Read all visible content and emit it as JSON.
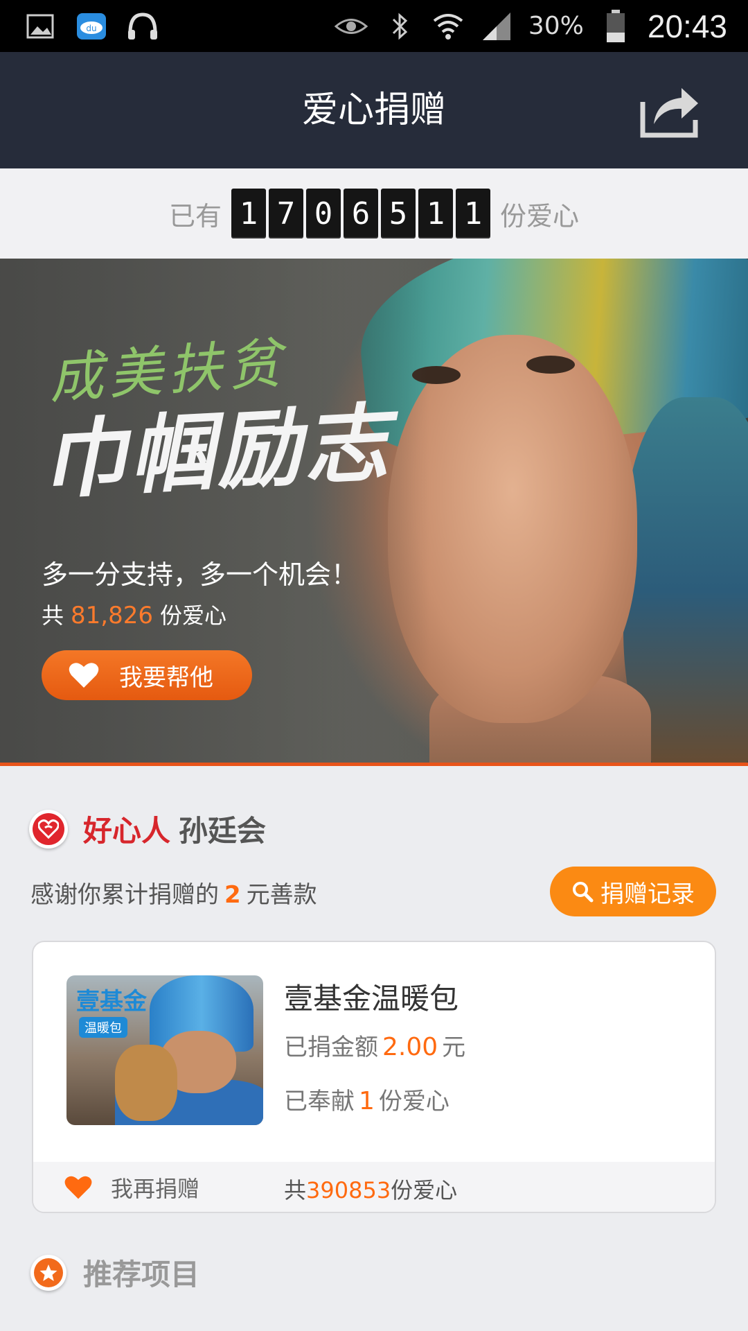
{
  "status_bar": {
    "left_icons": [
      "image-icon",
      "baidu-cloud-icon",
      "headphones-icon"
    ],
    "right_icons": [
      "eye-icon",
      "bluetooth-icon",
      "wifi-icon",
      "signal-icon",
      "battery-icon"
    ],
    "battery": "30%",
    "time": "20:43"
  },
  "header": {
    "title": "爱心捐赠",
    "share_icon": "share-icon"
  },
  "counter": {
    "prefix": "已有",
    "digits": [
      "1",
      "7",
      "0",
      "6",
      "5",
      "1",
      "1"
    ],
    "suffix": "份爱心"
  },
  "banner": {
    "brush_line1": "成美扶贫",
    "brush_line2": "巾帼励志",
    "slogan": "多一分支持，多一个机会！",
    "total_prefix": "共",
    "total_value": "81,826",
    "total_suffix": "份爱心",
    "help_button": "我要帮他"
  },
  "donor": {
    "title_prefix": "好心人",
    "name": "孙廷会",
    "thanks_prefix": "感谢你累计捐赠的",
    "thanks_amount": "2",
    "thanks_suffix": "元善款",
    "record_button": "捐赠记录"
  },
  "project_card": {
    "image_logo": "壹基金",
    "image_sub": "温暖包",
    "title": "壹基金温暖包",
    "donated_label": "已捐金额",
    "donated_value": "2.00",
    "donated_unit": "元",
    "love_label": "已奉献",
    "love_value": "1",
    "love_unit": "份爱心",
    "again_button": "我再捐赠",
    "total_prefix": "共",
    "total_value": "390853",
    "total_suffix": "份爱心"
  },
  "recommended": {
    "title": "推荐项目"
  },
  "colors": {
    "header_bg": "#262c3a",
    "accent_orange": "#ff6a10",
    "button_orange": "#fb8a13",
    "good_red": "#d7262c"
  }
}
